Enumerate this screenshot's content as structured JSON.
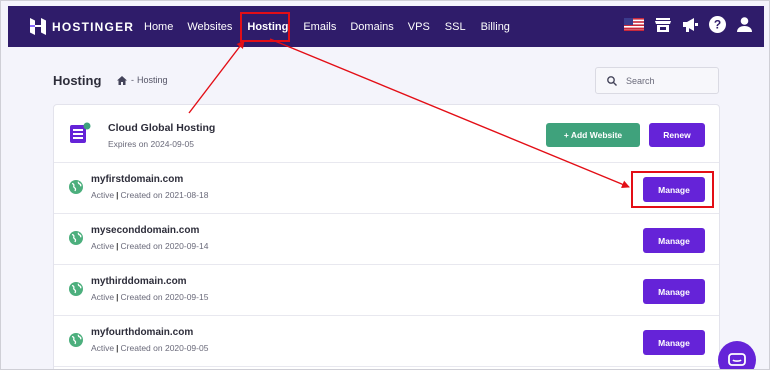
{
  "brand": {
    "name": "HOSTINGER"
  },
  "nav": {
    "items": [
      {
        "label": "Home"
      },
      {
        "label": "Websites"
      },
      {
        "label": "Hosting"
      },
      {
        "label": "Emails"
      },
      {
        "label": "Domains"
      },
      {
        "label": "VPS"
      },
      {
        "label": "SSL"
      },
      {
        "label": "Billing"
      }
    ],
    "icons": [
      "us-flag-icon",
      "store-icon",
      "megaphone-icon",
      "help-icon",
      "user-icon"
    ]
  },
  "header": {
    "title": "Hosting",
    "breadcrumb_separator": "-",
    "breadcrumb_current": "Hosting",
    "search_placeholder": "Search"
  },
  "plan": {
    "name": "Cloud Global Hosting",
    "expires": "Expires on 2024-09-05",
    "add_website_label": "+ Add Website",
    "renew_label": "Renew"
  },
  "domains": [
    {
      "name": "myfirstdomain.com",
      "status": "Active",
      "created": "Created on 2021-08-18",
      "button": "Manage"
    },
    {
      "name": "myseconddomain.com",
      "status": "Active",
      "created": "Created on 2020-09-14",
      "button": "Manage"
    },
    {
      "name": "mythirddomain.com",
      "status": "Active",
      "created": "Created on 2020-09-15",
      "button": "Manage"
    },
    {
      "name": "myfourthdomain.com",
      "status": "Active",
      "created": "Created on 2020-09-05",
      "button": "Manage"
    }
  ],
  "colors": {
    "nav_bg": "#2f1c6a",
    "primary": "#6523d8",
    "success": "#3fa27c",
    "annotation_red": "#e30e16",
    "globe_green": "#4caf7d"
  }
}
